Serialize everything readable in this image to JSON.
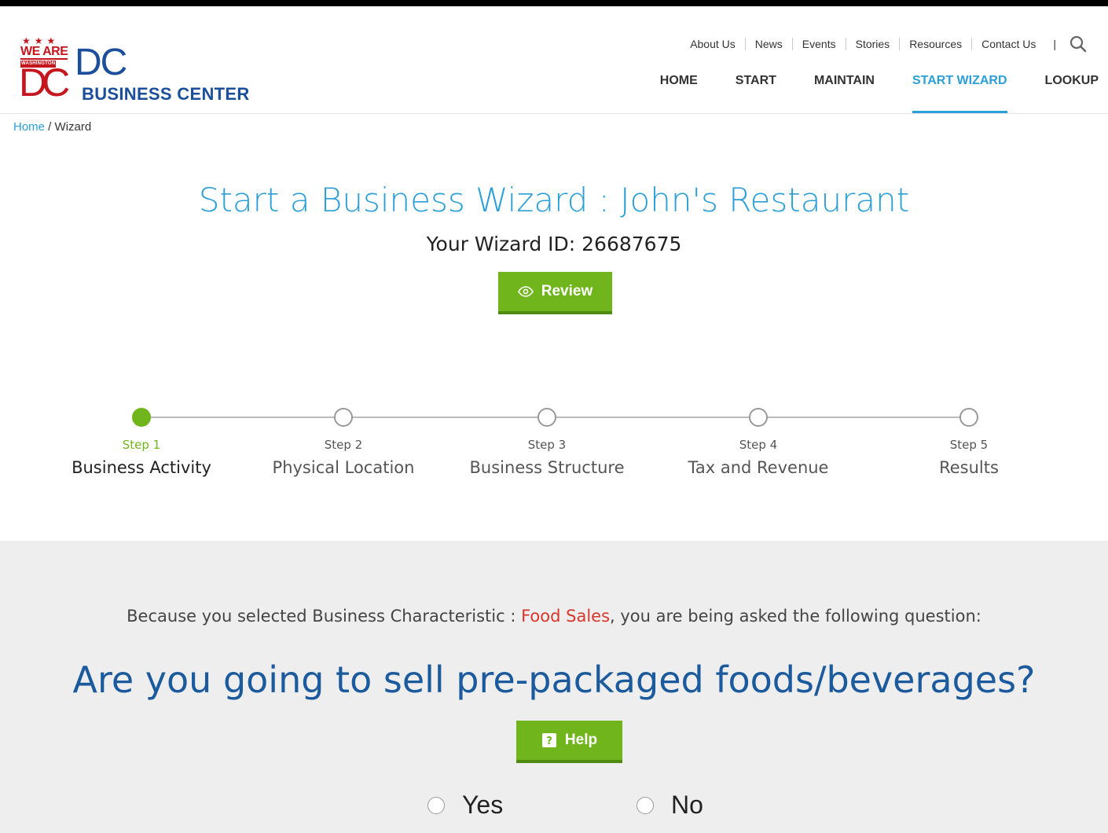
{
  "logo": {
    "we_are": "WE ARE",
    "washington": "WASHINGTON",
    "dc_mark": "DC",
    "dc": "DC",
    "business_center": "BUSINESS CENTER",
    "red": "#c4161c",
    "blue": "#1b4f9c"
  },
  "utility_nav": [
    "About Us",
    "News",
    "Events",
    "Stories",
    "Resources",
    "Contact Us"
  ],
  "utility_separator": "|",
  "main_nav": [
    {
      "label": "HOME"
    },
    {
      "label": "START"
    },
    {
      "label": "MAINTAIN"
    },
    {
      "label": "START WIZARD",
      "active": true
    },
    {
      "label": "LOOKUP"
    }
  ],
  "breadcrumb": {
    "home": "Home",
    "separator": " / ",
    "current": "Wizard"
  },
  "title": "Start a Business Wizard : John's Restaurant",
  "wizard_id": "Your Wizard ID: 26687675",
  "review_label": "Review",
  "steps": [
    {
      "num": "Step 1",
      "label": "Business Activity",
      "active": true
    },
    {
      "num": "Step 2",
      "label": "Physical Location",
      "active": false
    },
    {
      "num": "Step 3",
      "label": "Business Structure",
      "active": false
    },
    {
      "num": "Step 4",
      "label": "Tax and Revenue",
      "active": false
    },
    {
      "num": "Step 5",
      "label": "Results",
      "active": false
    }
  ],
  "because": {
    "prefix": "Because you selected Business Characteristic : ",
    "highlight": "Food Sales",
    "suffix": ", you are being asked the following question:"
  },
  "question": "Are you going to sell pre-packaged foods/beverages?",
  "help_label": "Help",
  "options": {
    "yes": "Yes",
    "no": "No"
  },
  "colors": {
    "accent": "#2c9fd8",
    "green": "#6fb51b",
    "question": "#1b5a9c",
    "highlight": "#d9362b"
  }
}
